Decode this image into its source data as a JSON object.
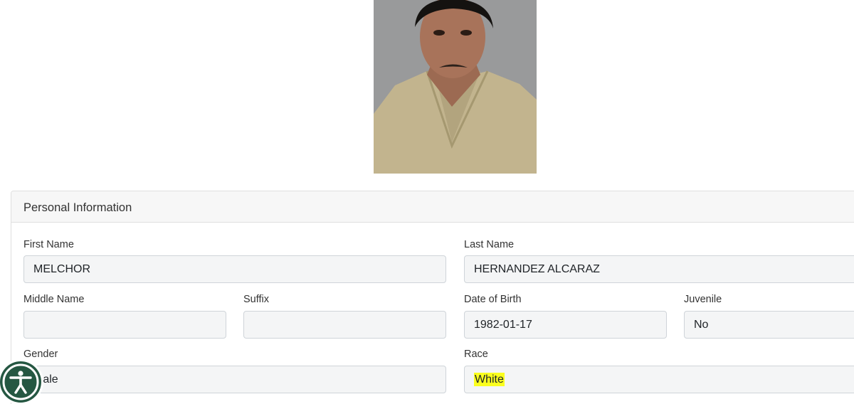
{
  "photo": {
    "icon": "person-photo"
  },
  "section": {
    "title": "Personal Information"
  },
  "fields": {
    "first_name": {
      "label": "First Name",
      "value": "MELCHOR"
    },
    "last_name": {
      "label": "Last Name",
      "value": "HERNANDEZ ALCARAZ"
    },
    "middle_name": {
      "label": "Middle Name",
      "value": ""
    },
    "suffix": {
      "label": "Suffix",
      "value": ""
    },
    "dob": {
      "label": "Date of Birth",
      "value": "1982-01-17"
    },
    "juvenile": {
      "label": "Juvenile",
      "value": "No"
    },
    "gender": {
      "label": "Gender",
      "value": "Male"
    },
    "race": {
      "label": "Race",
      "value": "White"
    }
  },
  "accessibility": {
    "icon": "accessibility-icon",
    "color": "#255742"
  },
  "colors": {
    "highlight": "#fbff1e",
    "field_bg": "#f4f5f6",
    "header_bg": "#f7f7f7"
  }
}
